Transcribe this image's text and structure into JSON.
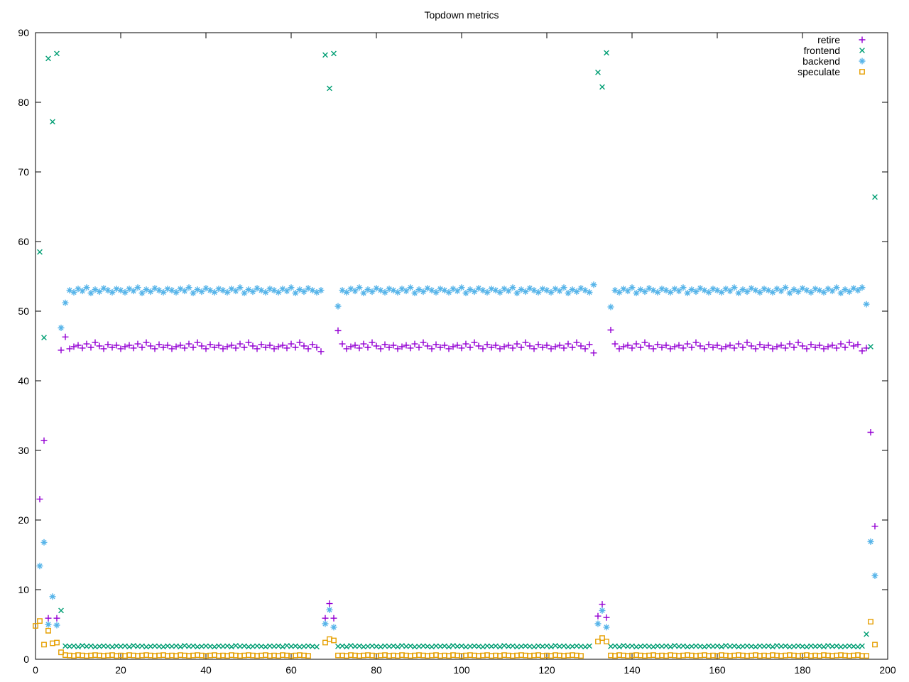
{
  "title": "Topdown metrics",
  "chart_data": {
    "type": "scatter",
    "title": "Topdown metrics",
    "xlabel": "",
    "ylabel": "",
    "xlim": [
      0,
      200
    ],
    "ylim": [
      0,
      90
    ],
    "xticks": [
      0,
      20,
      40,
      60,
      80,
      100,
      120,
      140,
      160,
      180,
      200
    ],
    "yticks": [
      0,
      10,
      20,
      30,
      40,
      50,
      60,
      70,
      80,
      90
    ],
    "grid": false,
    "legend_position": "top-right-inside",
    "legend_order": [
      "retire",
      "frontend",
      "backend",
      "speculate"
    ],
    "x_is_sample_index": true,
    "series": [
      {
        "name": "retire",
        "marker": "plus",
        "color": "#9400d3",
        "values": [
          null,
          23.0,
          31.4,
          5.9,
          null,
          5.9,
          44.4,
          46.3,
          44.6,
          44.9,
          45.1,
          44.7,
          45.3,
          44.8,
          45.5,
          45.0,
          44.6,
          45.2,
          44.8,
          45.1,
          44.6,
          44.9,
          45.1,
          44.7,
          45.3,
          44.8,
          45.5,
          45.0,
          44.6,
          45.2,
          44.8,
          45.1,
          44.6,
          44.9,
          45.1,
          44.7,
          45.3,
          44.8,
          45.5,
          45.0,
          44.6,
          45.2,
          44.8,
          45.1,
          44.6,
          44.9,
          45.1,
          44.7,
          45.3,
          44.8,
          45.5,
          45.0,
          44.6,
          45.2,
          44.8,
          45.1,
          44.6,
          44.9,
          45.1,
          44.7,
          45.3,
          44.8,
          45.5,
          45.0,
          44.6,
          45.2,
          44.8,
          44.2,
          5.9,
          8.0,
          5.9,
          47.2,
          45.3,
          44.6,
          44.9,
          45.1,
          44.7,
          45.3,
          44.8,
          45.5,
          45.0,
          44.6,
          45.2,
          44.8,
          45.1,
          44.6,
          44.9,
          45.1,
          44.7,
          45.3,
          44.8,
          45.5,
          45.0,
          44.6,
          45.2,
          44.8,
          45.1,
          44.6,
          44.9,
          45.1,
          44.7,
          45.3,
          44.8,
          45.5,
          45.0,
          44.6,
          45.2,
          44.8,
          45.1,
          44.6,
          44.9,
          45.1,
          44.7,
          45.3,
          44.8,
          45.5,
          45.0,
          44.6,
          45.2,
          44.8,
          45.1,
          44.6,
          44.9,
          45.1,
          44.7,
          45.3,
          44.8,
          45.5,
          45.0,
          44.6,
          45.2,
          44.0,
          6.2,
          7.9,
          6.0,
          47.3,
          45.3,
          44.6,
          44.9,
          45.1,
          44.7,
          45.3,
          44.8,
          45.5,
          45.0,
          44.6,
          45.2,
          44.8,
          45.1,
          44.6,
          44.9,
          45.1,
          44.7,
          45.3,
          44.8,
          45.5,
          45.0,
          44.6,
          45.2,
          44.8,
          45.1,
          44.6,
          44.9,
          45.1,
          44.7,
          45.3,
          44.8,
          45.5,
          45.0,
          44.6,
          45.2,
          44.8,
          45.1,
          44.6,
          44.9,
          45.1,
          44.7,
          45.3,
          44.8,
          45.5,
          45.0,
          44.6,
          45.2,
          44.8,
          45.1,
          44.6,
          44.9,
          45.1,
          44.7,
          45.3,
          44.8,
          45.5,
          45.0,
          45.2,
          44.3,
          44.7,
          32.6,
          19.1
        ]
      },
      {
        "name": "frontend",
        "marker": "cross",
        "color": "#009e73",
        "values": [
          null,
          58.5,
          46.2,
          86.3,
          77.2,
          87.0,
          7.0,
          1.9,
          1.85,
          1.9,
          1.8,
          1.95,
          1.85,
          1.9,
          1.8,
          1.85,
          1.9,
          1.85,
          1.8,
          1.9,
          1.85,
          1.9,
          1.8,
          1.95,
          1.85,
          1.9,
          1.8,
          1.85,
          1.9,
          1.85,
          1.8,
          1.9,
          1.85,
          1.9,
          1.8,
          1.95,
          1.85,
          1.9,
          1.8,
          1.85,
          1.9,
          1.85,
          1.8,
          1.9,
          1.85,
          1.9,
          1.8,
          1.95,
          1.85,
          1.9,
          1.8,
          1.85,
          1.9,
          1.85,
          1.8,
          1.9,
          1.85,
          1.9,
          1.8,
          1.95,
          1.85,
          1.9,
          1.8,
          1.85,
          1.9,
          1.85,
          1.8,
          null,
          86.8,
          82.0,
          87.0,
          1.85,
          1.9,
          1.8,
          1.95,
          1.85,
          1.9,
          1.8,
          1.85,
          1.9,
          1.85,
          1.8,
          1.9,
          1.85,
          1.9,
          1.8,
          1.95,
          1.85,
          1.9,
          1.8,
          1.85,
          1.9,
          1.85,
          1.8,
          1.9,
          1.85,
          1.9,
          1.8,
          1.95,
          1.85,
          1.9,
          1.8,
          1.85,
          1.9,
          1.85,
          1.8,
          1.9,
          1.85,
          1.9,
          1.8,
          1.95,
          1.85,
          1.9,
          1.8,
          1.85,
          1.9,
          1.85,
          1.8,
          1.9,
          1.85,
          1.9,
          1.8,
          1.95,
          1.85,
          1.9,
          1.8,
          1.85,
          1.9,
          1.85,
          1.8,
          1.9,
          null,
          84.3,
          82.2,
          87.1,
          1.85,
          1.9,
          1.8,
          1.95,
          1.85,
          1.9,
          1.8,
          1.85,
          1.9,
          1.85,
          1.8,
          1.9,
          1.85,
          1.9,
          1.8,
          1.95,
          1.85,
          1.9,
          1.8,
          1.85,
          1.9,
          1.85,
          1.8,
          1.9,
          1.85,
          1.9,
          1.8,
          1.95,
          1.85,
          1.9,
          1.8,
          1.85,
          1.9,
          1.85,
          1.8,
          1.9,
          1.85,
          1.9,
          1.8,
          1.95,
          1.85,
          1.9,
          1.8,
          1.85,
          1.9,
          1.85,
          1.8,
          1.9,
          1.85,
          1.9,
          1.8,
          1.95,
          1.85,
          1.9,
          1.8,
          1.85,
          1.9,
          1.85,
          1.8,
          1.9,
          3.6,
          44.9,
          66.4
        ]
      },
      {
        "name": "backend",
        "marker": "asterisk",
        "color": "#56b4e9",
        "values": [
          null,
          13.4,
          16.8,
          5.0,
          9.0,
          4.9,
          47.6,
          51.2,
          53.0,
          52.7,
          53.2,
          52.9,
          53.4,
          52.6,
          53.1,
          52.8,
          53.3,
          53.0,
          52.7,
          53.2,
          53.0,
          52.7,
          53.2,
          52.9,
          53.4,
          52.6,
          53.1,
          52.8,
          53.3,
          53.0,
          52.7,
          53.2,
          53.0,
          52.7,
          53.2,
          52.9,
          53.4,
          52.6,
          53.1,
          52.8,
          53.3,
          53.0,
          52.7,
          53.2,
          53.0,
          52.7,
          53.2,
          52.9,
          53.4,
          52.6,
          53.1,
          52.8,
          53.3,
          53.0,
          52.7,
          53.2,
          53.0,
          52.7,
          53.2,
          52.9,
          53.4,
          52.6,
          53.1,
          52.8,
          53.3,
          53.0,
          52.7,
          53.0,
          5.1,
          7.1,
          4.6,
          50.7,
          53.0,
          52.7,
          53.2,
          52.9,
          53.4,
          52.6,
          53.1,
          52.8,
          53.3,
          53.0,
          52.7,
          53.2,
          53.0,
          52.7,
          53.2,
          52.9,
          53.4,
          52.6,
          53.1,
          52.8,
          53.3,
          53.0,
          52.7,
          53.2,
          53.0,
          52.7,
          53.2,
          52.9,
          53.4,
          52.6,
          53.1,
          52.8,
          53.3,
          53.0,
          52.7,
          53.2,
          53.0,
          52.7,
          53.2,
          52.9,
          53.4,
          52.6,
          53.1,
          52.8,
          53.3,
          53.0,
          52.7,
          53.2,
          53.0,
          52.7,
          53.2,
          52.9,
          53.4,
          52.6,
          53.1,
          52.8,
          53.3,
          53.0,
          52.7,
          53.8,
          5.1,
          7.0,
          4.6,
          50.6,
          53.0,
          52.7,
          53.2,
          52.9,
          53.4,
          52.6,
          53.1,
          52.8,
          53.3,
          53.0,
          52.7,
          53.2,
          53.0,
          52.7,
          53.2,
          52.9,
          53.4,
          52.6,
          53.1,
          52.8,
          53.3,
          53.0,
          52.7,
          53.2,
          53.0,
          52.7,
          53.2,
          52.9,
          53.4,
          52.6,
          53.1,
          52.8,
          53.3,
          53.0,
          52.7,
          53.2,
          53.0,
          52.7,
          53.2,
          52.9,
          53.4,
          52.6,
          53.1,
          52.8,
          53.3,
          53.0,
          52.7,
          53.2,
          53.0,
          52.7,
          53.2,
          52.9,
          53.4,
          52.6,
          53.1,
          52.8,
          53.3,
          53.0,
          53.4,
          51.0,
          16.9,
          12.0
        ]
      },
      {
        "name": "speculate",
        "marker": "square",
        "color": "#e69f00",
        "values": [
          4.8,
          5.5,
          2.1,
          4.1,
          2.3,
          2.4,
          1.0,
          0.6,
          0.55,
          0.5,
          0.6,
          0.55,
          0.5,
          0.55,
          0.6,
          0.55,
          0.5,
          0.55,
          0.6,
          0.5,
          0.55,
          0.5,
          0.6,
          0.55,
          0.5,
          0.55,
          0.6,
          0.55,
          0.5,
          0.55,
          0.6,
          0.5,
          0.55,
          0.5,
          0.6,
          0.55,
          0.5,
          0.55,
          0.6,
          0.55,
          0.5,
          0.55,
          0.6,
          0.5,
          0.55,
          0.5,
          0.6,
          0.55,
          0.5,
          0.55,
          0.6,
          0.55,
          0.5,
          0.55,
          0.6,
          0.5,
          0.55,
          0.5,
          0.6,
          0.55,
          0.5,
          0.55,
          0.6,
          0.55,
          0.5,
          null,
          null,
          null,
          2.4,
          2.9,
          2.7,
          0.55,
          0.55,
          0.5,
          0.6,
          0.55,
          0.5,
          0.55,
          0.6,
          0.55,
          0.5,
          0.55,
          0.6,
          0.5,
          0.55,
          0.5,
          0.6,
          0.55,
          0.5,
          0.55,
          0.6,
          0.55,
          0.5,
          0.55,
          0.6,
          0.5,
          0.55,
          0.5,
          0.6,
          0.55,
          0.5,
          0.55,
          0.6,
          0.55,
          0.5,
          0.55,
          0.6,
          0.5,
          0.55,
          0.5,
          0.6,
          0.55,
          0.5,
          0.55,
          0.6,
          0.55,
          0.5,
          0.55,
          0.6,
          0.5,
          0.55,
          0.5,
          0.6,
          0.55,
          0.5,
          0.55,
          0.6,
          0.55,
          0.5,
          null,
          null,
          null,
          2.55,
          3.05,
          2.55,
          0.55,
          0.5,
          0.6,
          0.55,
          0.5,
          0.55,
          0.6,
          0.55,
          0.5,
          0.55,
          0.6,
          0.5,
          0.55,
          0.5,
          0.6,
          0.55,
          0.5,
          0.55,
          0.6,
          0.55,
          0.5,
          0.55,
          0.6,
          0.5,
          0.55,
          0.5,
          0.6,
          0.55,
          0.5,
          0.55,
          0.6,
          0.55,
          0.5,
          0.55,
          0.6,
          0.5,
          0.55,
          0.5,
          0.6,
          0.55,
          0.5,
          0.55,
          0.6,
          0.55,
          0.5,
          0.55,
          0.6,
          0.5,
          0.55,
          0.5,
          0.6,
          0.55,
          0.5,
          0.55,
          0.6,
          0.55,
          0.5,
          0.55,
          0.6,
          0.5,
          0.5,
          5.4,
          2.1
        ]
      }
    ]
  }
}
